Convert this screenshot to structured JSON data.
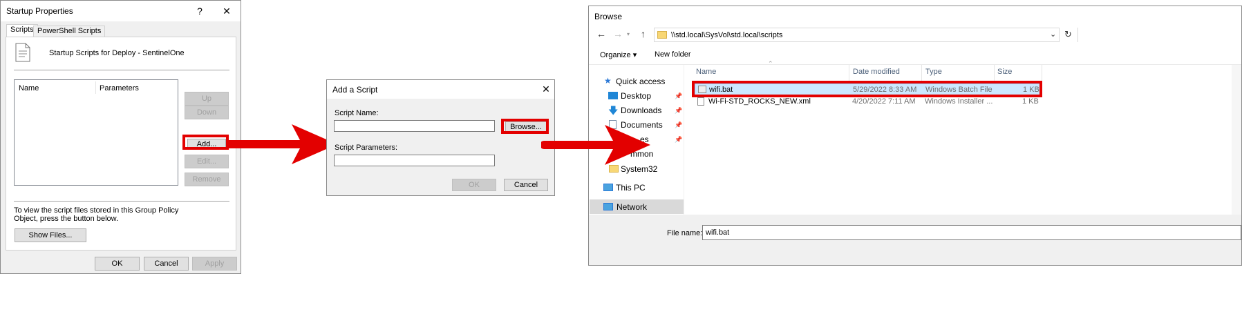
{
  "startup": {
    "title": "Startup Properties",
    "help": "?",
    "close": "✕",
    "tabs": [
      "Scripts",
      "PowerShell Scripts"
    ],
    "heading": "Startup Scripts for Deploy - SentinelOne",
    "columns": [
      "Name",
      "Parameters"
    ],
    "buttons": {
      "up": "Up",
      "down": "Down",
      "add": "Add...",
      "edit": "Edit...",
      "remove": "Remove"
    },
    "info": "To view the script files stored in this Group Policy Object, press the button below.",
    "show_files": "Show Files...",
    "ok": "OK",
    "cancel": "Cancel",
    "apply": "Apply"
  },
  "add_script": {
    "title": "Add a Script",
    "close": "✕",
    "script_name_label": "Script Name:",
    "script_name_value": "",
    "params_label": "Script Parameters:",
    "params_value": "",
    "browse": "Browse...",
    "ok": "OK",
    "cancel": "Cancel"
  },
  "browse": {
    "title": "Browse",
    "address": "\\\\std.local\\SysVol\\std.local\\scripts",
    "toolbar": {
      "organize": "Organize ▾",
      "new_folder": "New folder"
    },
    "nav": {
      "quick_access": "Quick access",
      "desktop": "Desktop",
      "downloads": "Downloads",
      "documents": "Documents",
      "pictures_partial": "es",
      "common_partial": "mmon",
      "system32": "System32",
      "this_pc": "This PC",
      "network": "Network"
    },
    "columns": {
      "name": "Name",
      "date": "Date modified",
      "type": "Type",
      "size": "Size"
    },
    "files": [
      {
        "name": "wifi.bat",
        "date": "5/29/2022 8:33 AM",
        "type": "Windows Batch File",
        "size": "1 KB"
      },
      {
        "name": "Wi-Fi-STD_ROCKS_NEW.xml",
        "date": "4/20/2022 7:11 AM",
        "type": "Windows Installer ...",
        "size": "1 KB"
      }
    ],
    "file_name_label": "File name:",
    "file_name_value": "wifi.bat"
  },
  "colors": {
    "highlight": "#e30000",
    "selection": "#cce8ff"
  }
}
